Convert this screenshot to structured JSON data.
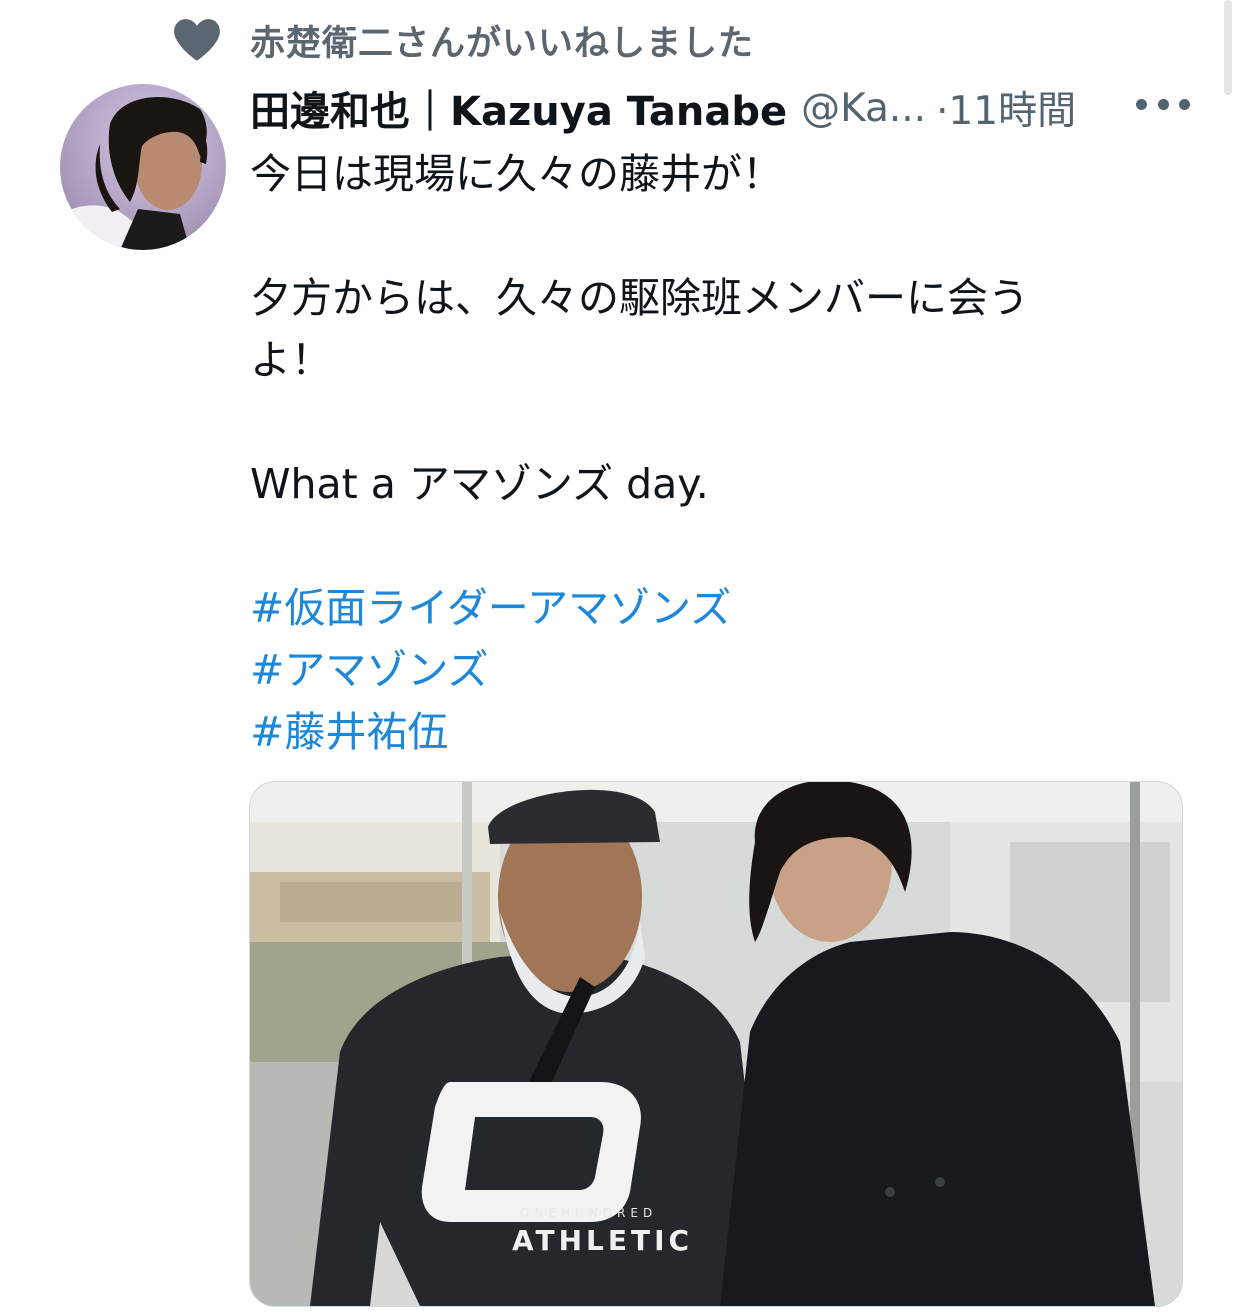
{
  "context": {
    "icon": "heart-icon",
    "text": "赤楚衛二さんがいいねしました"
  },
  "tweet": {
    "author_name": "田邊和也｜Kazuya Tanabe",
    "handle": "@Ka...",
    "time": "·11時間",
    "text_lines": {
      "l1": "今日は現場に久々の藤井が！",
      "l2": "夕方からは、久々の駆除班メンバーに会う",
      "l3": "よ！",
      "l4": "What a アマゾンズ day."
    },
    "hashtags": [
      "#仮面ライダーアマゾンズ",
      "#アマゾンズ",
      "#藤井祐伍"
    ],
    "shirt_print": {
      "line1": "ONEHUNDRED",
      "line2": "ATHLETIC"
    }
  },
  "colors": {
    "link": "#1d87d9",
    "secondary_text": "#536471",
    "context_text": "#5b6670"
  }
}
